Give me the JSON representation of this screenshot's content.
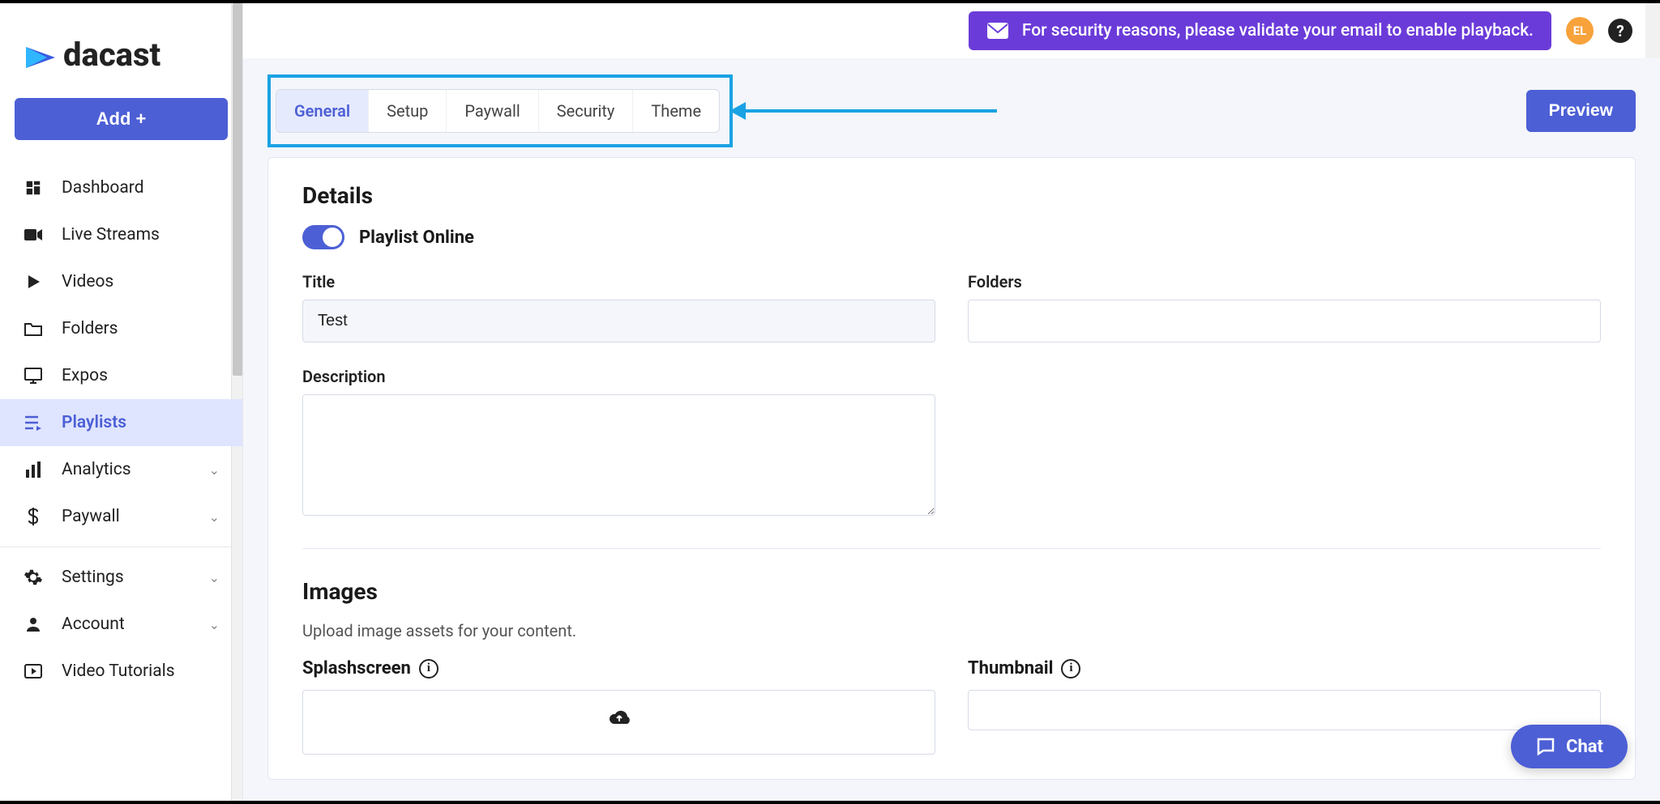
{
  "brand": {
    "name": "dacast"
  },
  "sidebar": {
    "add_label": "Add +",
    "items": [
      {
        "label": "Dashboard",
        "icon": "dashboard"
      },
      {
        "label": "Live Streams",
        "icon": "camera"
      },
      {
        "label": "Videos",
        "icon": "play"
      },
      {
        "label": "Folders",
        "icon": "folder"
      },
      {
        "label": "Expos",
        "icon": "monitor"
      },
      {
        "label": "Playlists",
        "icon": "playlist",
        "active": true
      },
      {
        "label": "Analytics",
        "icon": "bars",
        "expandable": true
      },
      {
        "label": "Paywall",
        "icon": "dollar",
        "expandable": true
      }
    ],
    "bottom_items": [
      {
        "label": "Settings",
        "icon": "gear",
        "expandable": true
      },
      {
        "label": "Account",
        "icon": "person",
        "expandable": true
      },
      {
        "label": "Video Tutorials",
        "icon": "video-play"
      }
    ]
  },
  "topbar": {
    "alert": "For security reasons, please validate your email to enable playback.",
    "avatar_initials": "EL"
  },
  "tabs": {
    "items": [
      "General",
      "Setup",
      "Paywall",
      "Security",
      "Theme"
    ],
    "active_index": 0,
    "preview_label": "Preview"
  },
  "details": {
    "section_title": "Details",
    "toggle_label": "Playlist Online",
    "toggle_on": true,
    "title_label": "Title",
    "title_value": "Test",
    "folders_label": "Folders",
    "folders_value": "",
    "description_label": "Description",
    "description_value": ""
  },
  "images": {
    "section_title": "Images",
    "subtext": "Upload image assets for your content.",
    "splash_label": "Splashscreen",
    "thumb_label": "Thumbnail"
  },
  "chat": {
    "label": "Chat"
  }
}
